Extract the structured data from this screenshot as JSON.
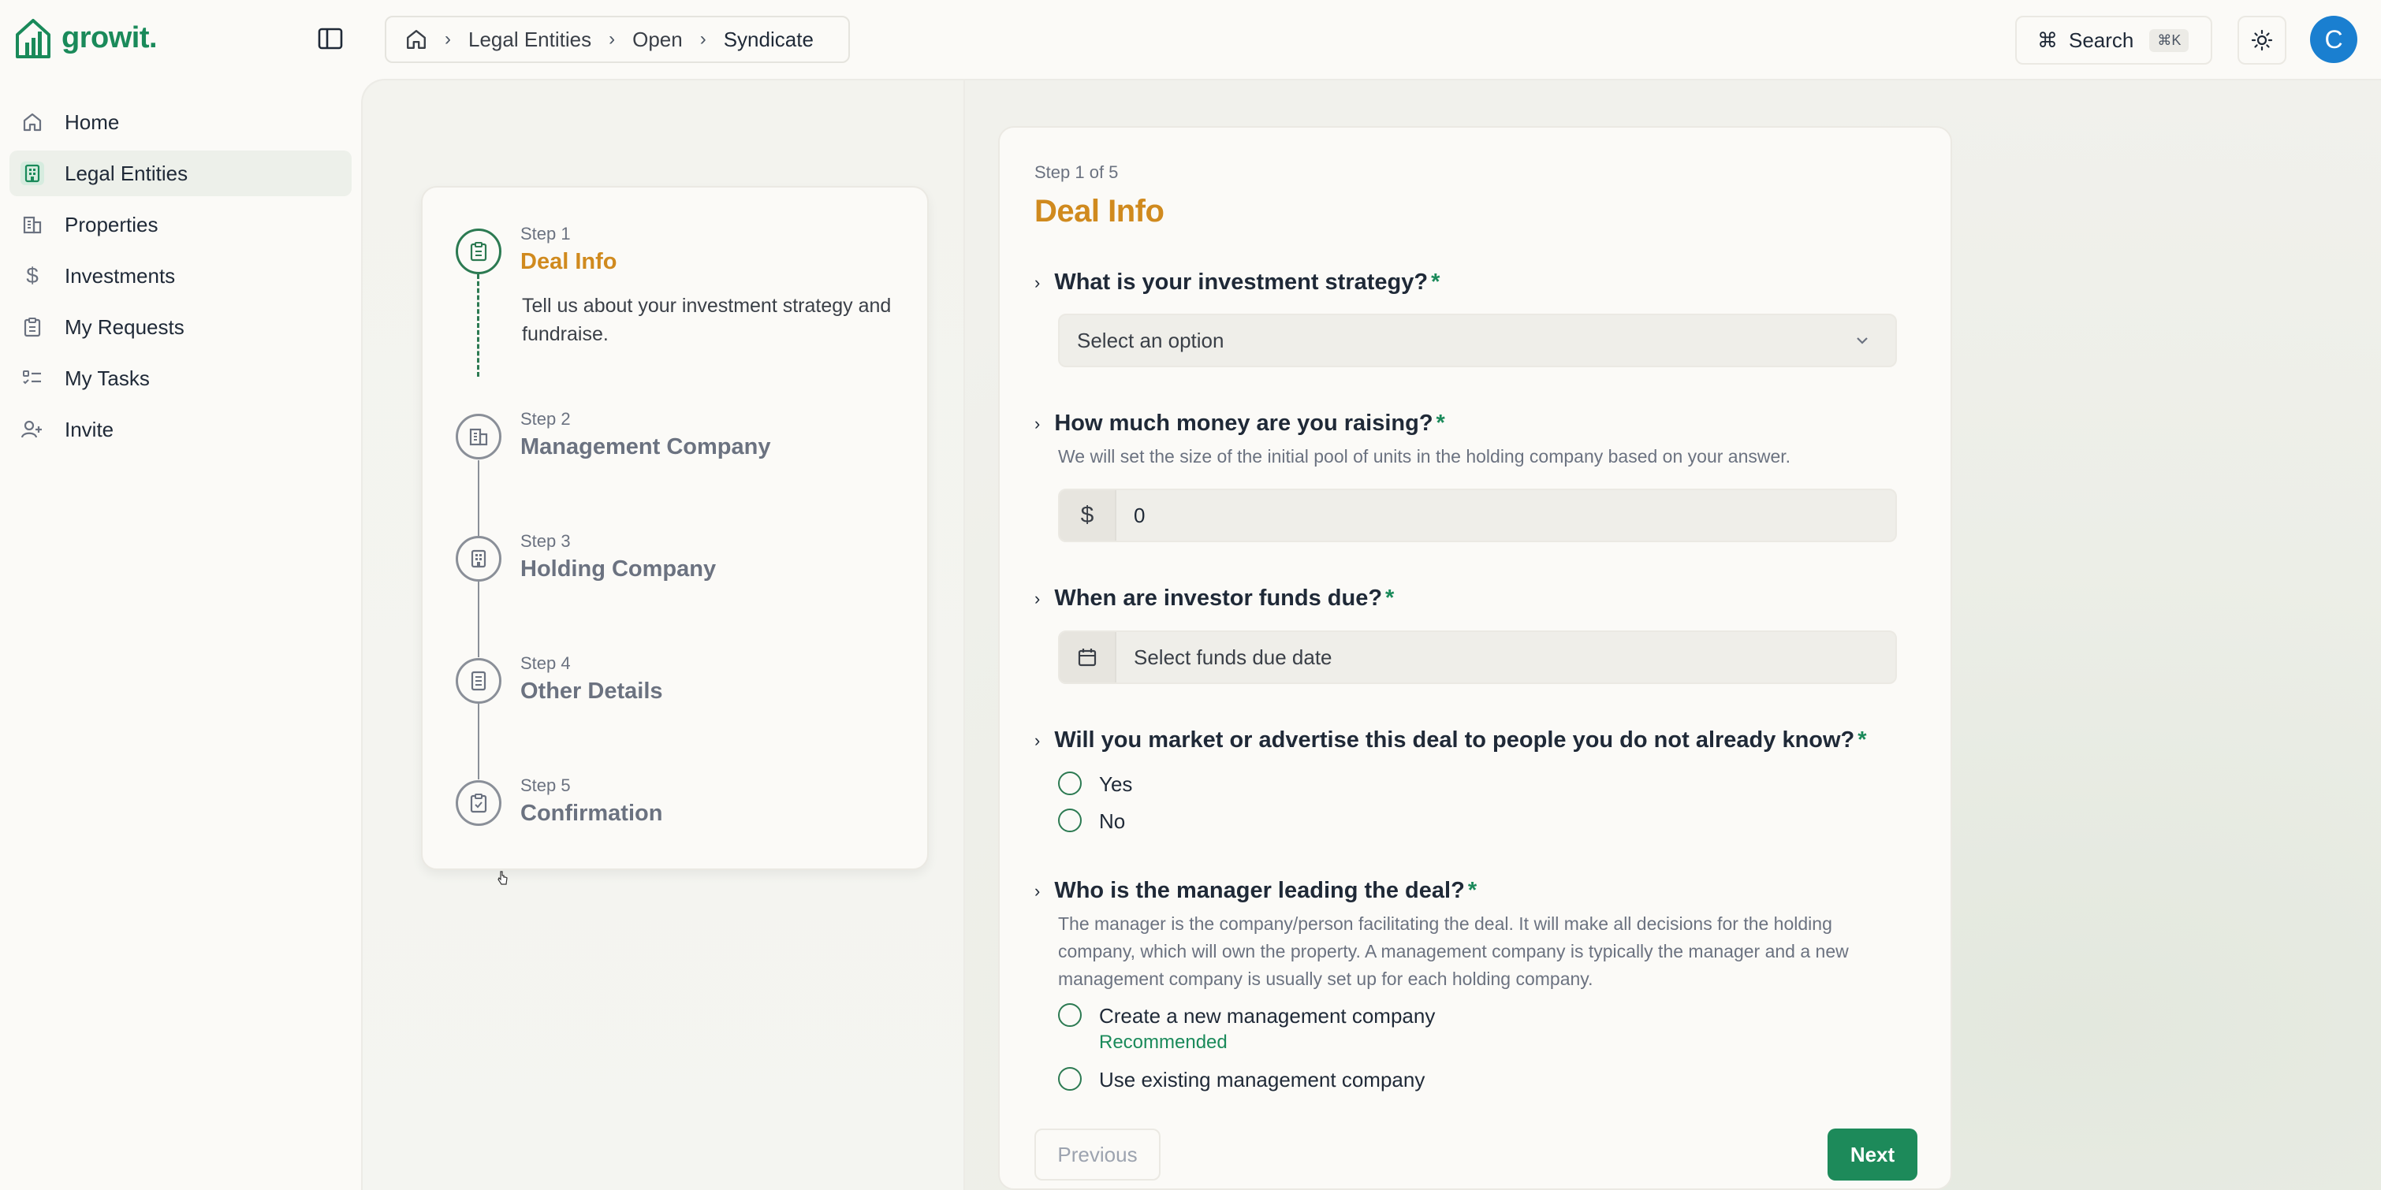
{
  "app": {
    "logo_text": "growit.",
    "avatar_letter": "C"
  },
  "sidebar": {
    "items": [
      {
        "label": "Home",
        "icon": "home-icon"
      },
      {
        "label": "Legal Entities",
        "icon": "building-icon",
        "active": true
      },
      {
        "label": "Properties",
        "icon": "buildings-icon"
      },
      {
        "label": "Investments",
        "icon": "dollar-icon"
      },
      {
        "label": "My Requests",
        "icon": "clipboard-icon"
      },
      {
        "label": "My Tasks",
        "icon": "task-list-icon"
      },
      {
        "label": "Invite",
        "icon": "user-plus-icon"
      }
    ]
  },
  "breadcrumb": {
    "items": [
      "Legal Entities",
      "Open",
      "Syndicate"
    ]
  },
  "header": {
    "search_label": "Search",
    "search_shortcut": "⌘K"
  },
  "steps": [
    {
      "num": "Step 1",
      "title": "Deal Info",
      "desc": "Tell us about your investment strategy and fundraise."
    },
    {
      "num": "Step 2",
      "title": "Management Company"
    },
    {
      "num": "Step 3",
      "title": "Holding Company"
    },
    {
      "num": "Step 4",
      "title": "Other Details"
    },
    {
      "num": "Step 5",
      "title": "Confirmation"
    }
  ],
  "form": {
    "step_label": "Step 1 of 5",
    "title": "Deal Info",
    "q1": {
      "label": "What is your investment strategy?",
      "placeholder": "Select an option"
    },
    "q2": {
      "label": "How much money are you raising?",
      "hint": "We will set the size of the initial pool of units in the holding company based on your answer.",
      "prefix": "$",
      "value": "0"
    },
    "q3": {
      "label": "When are investor funds due?",
      "placeholder": "Select funds due date"
    },
    "q4": {
      "label": "Will you market or advertise this deal to people you do not already know?",
      "options": [
        "Yes",
        "No"
      ]
    },
    "q5": {
      "label": "Who is the manager leading the deal?",
      "hint": "The manager is the company/person facilitating the deal. It will make all decisions for the holding company, which will own the property. A management company is typically the manager and a new management company is usually set up for each holding company.",
      "options": [
        "Create a new management company",
        "Use existing management company"
      ],
      "recommended": "Recommended"
    },
    "required_mark": "*",
    "prev_label": "Previous",
    "next_label": "Next"
  },
  "colors": {
    "brand": "#1a8a5a",
    "accent": "#d08a1e",
    "avatar": "#1a7fd0"
  }
}
